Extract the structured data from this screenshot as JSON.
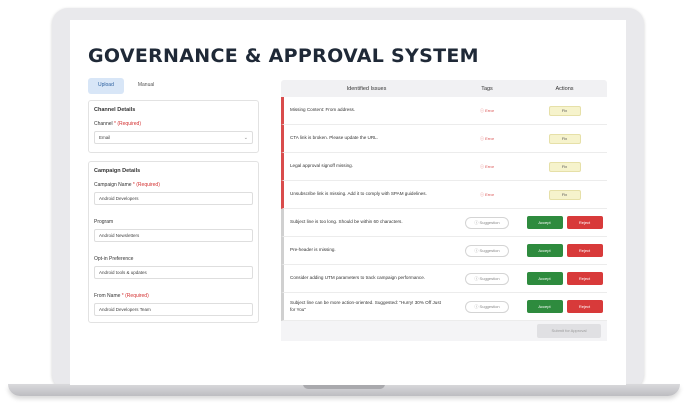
{
  "page": {
    "title": "GOVERNANCE & APPROVAL SYSTEM"
  },
  "tabs": [
    {
      "label": "Upload",
      "active": true
    },
    {
      "label": "Manual",
      "active": false
    }
  ],
  "channel_section": {
    "title": "Channel Details",
    "channel_label": "Channel",
    "required_text": "* (Required)",
    "channel_value": "Email"
  },
  "campaign_section": {
    "title": "Campaign Details",
    "campaign_name_label": "Campaign Name",
    "campaign_name_required": "* (Required)",
    "campaign_name_value": "Android Developers",
    "program_label": "Program",
    "program_value": "Android Newsletters",
    "optin_label": "Opt-in Preference",
    "optin_value": "Android tools & updates",
    "from_label": "From Name",
    "from_required": "* (Required)",
    "from_value": "Android Developers Team"
  },
  "table": {
    "headers": {
      "issue": "Identified Issues",
      "tags": "Tags",
      "actions": "Actions"
    },
    "rows": [
      {
        "issue": "Missing Content: From address.",
        "tag": "Error",
        "type": "error",
        "action": "Fix"
      },
      {
        "issue": "CTA link is broken. Please update the URL.",
        "tag": "Error",
        "type": "error",
        "action": "Fix"
      },
      {
        "issue": "Legal approval signoff missing.",
        "tag": "Error",
        "type": "error",
        "action": "Fix"
      },
      {
        "issue": "Unsubscribe link is missing. Add it to comply with SPAM guidelines.",
        "tag": "Error",
        "type": "error",
        "action": "Fix"
      },
      {
        "issue": "Subject line is too long. Should be within 60 characters.",
        "tag": "Suggestion",
        "type": "suggestion",
        "accept": "Accept",
        "reject": "Reject"
      },
      {
        "issue": "Pre-header is missing.",
        "tag": "Suggestion",
        "type": "suggestion",
        "accept": "Accept",
        "reject": "Reject"
      },
      {
        "issue": "Consider adding UTM parameters to track campaign performance.",
        "tag": "Suggestion",
        "type": "suggestion",
        "accept": "Accept",
        "reject": "Reject"
      },
      {
        "issue": "Subject line can be more action-oriented. Suggested: \"Hurry! 30% Off Just for You\"",
        "tag": "Suggestion",
        "type": "suggestion",
        "accept": "Accept",
        "reject": "Reject"
      }
    ],
    "submit_label": "Submit for Approval"
  },
  "colors": {
    "error": "#d94c4c",
    "accept": "#2e8b3e",
    "reject": "#d83a3a",
    "fix": "#f6f3cc",
    "tab_active": "#d8e6f7"
  }
}
